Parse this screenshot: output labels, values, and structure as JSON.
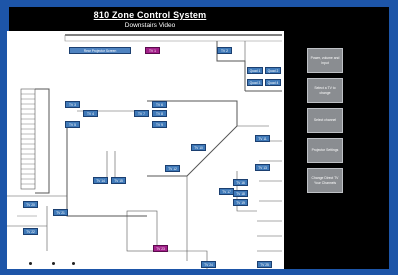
{
  "header": {
    "title": "810 Zone Control System",
    "subtitle": "Downstairs Video"
  },
  "sidebar": {
    "buttons": [
      {
        "label": "Power, volume and Input"
      },
      {
        "label": "Select a TV to change"
      },
      {
        "label": "Select channel"
      },
      {
        "label": "Projector Settings"
      },
      {
        "label": "Change Direct TV Your Channels"
      }
    ]
  },
  "plan": {
    "tvs": [
      {
        "label": "Rear Projector Screen"
      },
      {
        "label": "TV 1"
      },
      {
        "label": "TV 2"
      },
      {
        "label": "Quad 1"
      },
      {
        "label": "Quad 2"
      },
      {
        "label": "Quad 3"
      },
      {
        "label": "Quad 4"
      },
      {
        "label": "TV 3"
      },
      {
        "label": "TV 4"
      },
      {
        "label": "TV 5"
      },
      {
        "label": "TV 6"
      },
      {
        "label": "TV 7"
      },
      {
        "label": "TV 8"
      },
      {
        "label": "TV 9"
      },
      {
        "label": "TV 10"
      },
      {
        "label": "TV 11"
      },
      {
        "label": "TV 12"
      },
      {
        "label": "TV 13"
      },
      {
        "label": "TV 14"
      },
      {
        "label": "TV 15"
      },
      {
        "label": "TV 16"
      },
      {
        "label": "TV 17"
      },
      {
        "label": "TV 18"
      },
      {
        "label": "TV 19"
      },
      {
        "label": "TV 20"
      },
      {
        "label": "TV 21"
      },
      {
        "label": "TV 22"
      },
      {
        "label": "TV 23"
      },
      {
        "label": "TV 24"
      },
      {
        "label": "TV 25"
      }
    ]
  },
  "colors": {
    "background": "#1d55a8",
    "tv_button": "#3f79b8",
    "tv_button_selected": "#a3208a",
    "side_button": "#8a8d91"
  }
}
